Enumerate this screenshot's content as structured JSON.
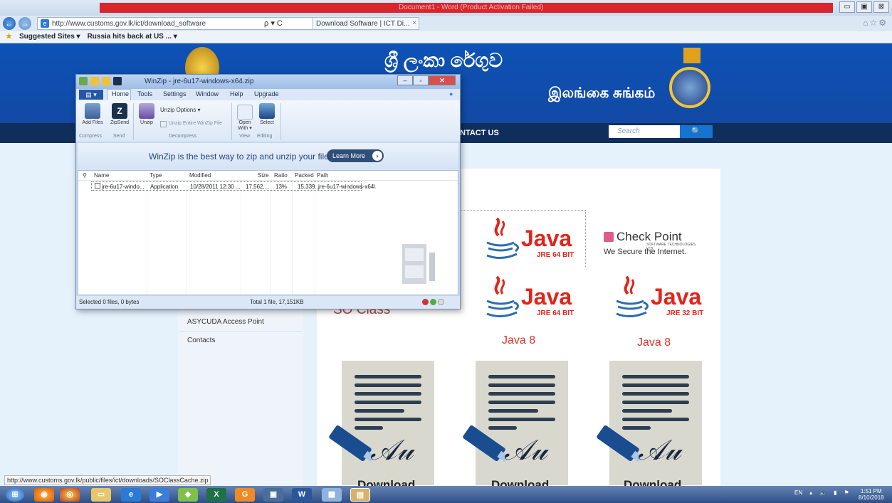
{
  "browser": {
    "title_bar_text": "Document1 - Word (Product Activation Failed)",
    "address": "http://www.customs.gov.lk/ict/download_software",
    "address_tools": "ρ ▾ C",
    "tab_title": "Download Software | ICT Di...",
    "tab_close": "×",
    "favorites": [
      "Suggested Sites ▾",
      "Russia hits back at US ... ▾"
    ],
    "status_url": "http://www.customs.gov.lk/public/files/ict/downloads/SOClassCache.zip",
    "window_controls": [
      "▭",
      "▣",
      "⊠"
    ]
  },
  "site": {
    "title_sinhala": "ශ්‍රී ලංකා රේගුව",
    "title_tamil": "இலங்கை சுங்கம்",
    "nav_contact": "NTACT US",
    "search_placeholder": "Search",
    "search_button": "🔍",
    "sidebar_links": [
      "ASYCUDA Access Point",
      "Contacts"
    ],
    "so_class": "SO Class",
    "java_word": "Java",
    "jre_64": "JRE 64 BIT",
    "jre_32": "JRE 32 BIT",
    "java8_labels": [
      "Java 8",
      "Java 8"
    ],
    "checkpoint_title": "Check Point",
    "checkpoint_sub": "SOFTWARE TECHNOLOGIES LTD.",
    "checkpoint_tagline": "We Secure the Internet.",
    "download_labels": [
      "Download",
      "Download",
      "Download"
    ]
  },
  "winzip": {
    "title": "WinZip - jre-6u17-windows-x64.zip",
    "tabs": [
      "Home",
      "Tools",
      "Settings",
      "Window",
      "Help",
      "Upgrade"
    ],
    "ribbon": {
      "add_files": "Add Files",
      "zipsend": "ZipSend",
      "unzip": "Unzip",
      "unzip_options": "Unzip Options ▾",
      "unzip_entire": "Unzip Entire WinZip File",
      "open_with": "Open With ▾",
      "select": "Select",
      "groups": [
        "Compress",
        "Send",
        "Decompress",
        "View",
        "Editing"
      ]
    },
    "banner": "WinZip is the best way to zip and unzip your files.",
    "learn_more": "Learn More",
    "columns": [
      "Name",
      "Type",
      "Modified",
      "Size",
      "Ratio",
      "Packed",
      "Path"
    ],
    "rows": [
      {
        "name": "jre-6u17-windo...",
        "type": "Application",
        "modified": "10/28/2011 12:30 ...",
        "size": "17,562,...",
        "ratio": "13%",
        "packed": "15,339...",
        "path": "jre-6u17-windows-x64\\"
      }
    ],
    "status_left": "Selected 0 files, 0 bytes",
    "status_mid": "Total 1 file, 17,151KB"
  },
  "taskbar": {
    "tray_lang": "EN",
    "time": "1:51 PM",
    "date": "8/10/2018"
  }
}
